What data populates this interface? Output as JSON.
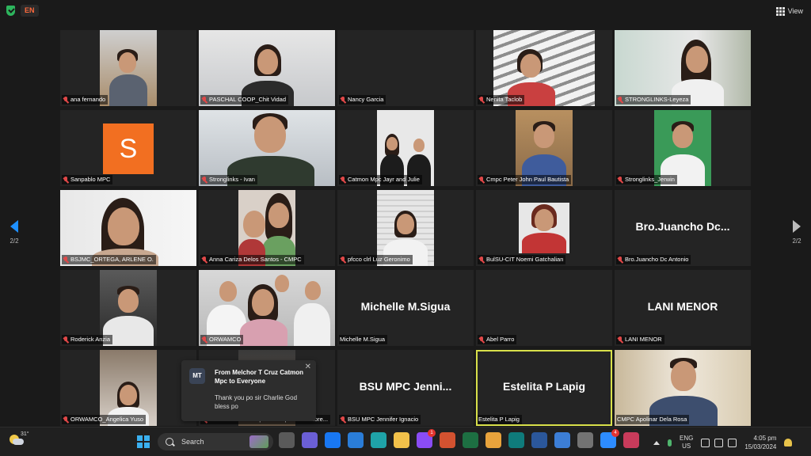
{
  "topbar": {
    "security_icon": "shield-check-icon",
    "language_badge": "EN",
    "view_label": "View"
  },
  "navigation": {
    "prev_page": "2/2",
    "next_page": "2/2"
  },
  "participants": [
    {
      "name": "ana fernando",
      "muted": true
    },
    {
      "name": "PASCHAL COOP_Chit Vidad",
      "muted": true
    },
    {
      "name": "Nancy Garcia",
      "muted": true
    },
    {
      "name": "Nenita Taclob",
      "muted": true
    },
    {
      "name": "STRONGLINKS-Leyeza",
      "muted": true
    },
    {
      "name": "Sanpablo MPC",
      "muted": true,
      "avatar_letter": "S",
      "avatar_color": "#f26f21"
    },
    {
      "name": "Stronglinks - Ivan",
      "muted": true
    },
    {
      "name": "Catmon Mpc Jayr and Julie",
      "muted": true
    },
    {
      "name": "Cmpc Peter John Paul Bautista",
      "muted": true
    },
    {
      "name": "Stronglinks_Jerwin",
      "muted": true
    },
    {
      "name": "BSJMC_ORTEGA, ARLENE O.",
      "muted": true
    },
    {
      "name": "Anna Cariza Delos Santos - CMPC",
      "muted": true
    },
    {
      "name": "pfcco clrl Luz Geronimo",
      "muted": true
    },
    {
      "name": "BulSU-CIT Noemi Gatchalian",
      "muted": true
    },
    {
      "name": "Bro.Juancho Dc Antonio",
      "muted": true,
      "display_name": "Bro.Juancho  Dc..."
    },
    {
      "name": "Roderick Anzia",
      "muted": true
    },
    {
      "name": "ORWAMCO",
      "muted": true
    },
    {
      "name": "Michelle M.Sigua",
      "muted": false,
      "display_name": "Michelle M.Sigua"
    },
    {
      "name": "Abel Parro",
      "muted": true
    },
    {
      "name": "LANI MENOR",
      "muted": true,
      "display_name": "LANI MENOR"
    },
    {
      "name": "ORWAMCO_Angelica Yuso",
      "muted": true
    },
    {
      "name": "Catmon MPC - Purpose Cooperative - Lore...",
      "muted": true
    },
    {
      "name": "BSU  MPC  Jennifer Ignacio",
      "muted": true,
      "display_name": "BSU  MPC  Jenni..."
    },
    {
      "name": "Estelita P Lapig",
      "muted": false,
      "display_name": "Estelita P Lapig",
      "active_speaker": true
    },
    {
      "name": "CMPC Apolinar Dela Rosa",
      "muted": false
    }
  ],
  "chat_notification": {
    "avatar_initials": "MT",
    "from": "From Melchor T Cruz Catmon Mpc to Everyone",
    "message": "Thank you po sir Charlie God bless po"
  },
  "taskbar": {
    "weather_temp": "31°",
    "search_placeholder": "Search",
    "apps": [
      {
        "icon": "file-explorer-widget-icon",
        "color": "#5a5a5a"
      },
      {
        "icon": "chat-app-icon",
        "color": "#6b5fd6"
      },
      {
        "icon": "facebook-icon",
        "color": "#1877f2"
      },
      {
        "icon": "mail-icon",
        "color": "#2a7dd8"
      },
      {
        "icon": "edge-icon",
        "color": "#1fa3a8"
      },
      {
        "icon": "folder-icon",
        "color": "#f2c14a"
      },
      {
        "icon": "messenger-icon",
        "color": "#8a4cf5",
        "badge": "1"
      },
      {
        "icon": "powerpoint-icon",
        "color": "#d35230"
      },
      {
        "icon": "excel-icon",
        "color": "#1d6f42"
      },
      {
        "icon": "chrome-icon",
        "color": "#e8a33c"
      },
      {
        "icon": "publisher-icon",
        "color": "#0f7b7b"
      },
      {
        "icon": "word-icon",
        "color": "#2b579a"
      },
      {
        "icon": "store-icon",
        "color": "#3c7ed6"
      },
      {
        "icon": "calculator-icon",
        "color": "#737373"
      },
      {
        "icon": "zoom-icon",
        "color": "#2d8cff",
        "badge": "4"
      },
      {
        "icon": "snipping-tool-icon",
        "color": "#c83b5b"
      }
    ],
    "language_line1": "ENG",
    "language_line2": "US",
    "time": "4:05 pm",
    "date": "15/03/2024"
  }
}
